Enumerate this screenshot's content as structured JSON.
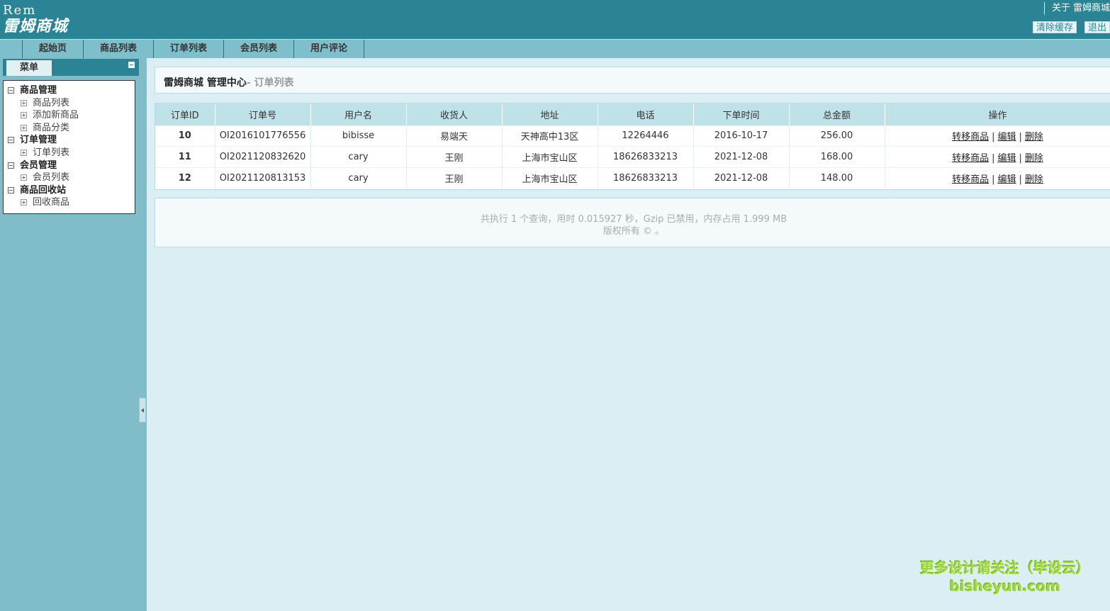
{
  "header": {
    "logo_en": "Rem",
    "logo_cn": "雷姆商城",
    "about_link": "关于 雷姆商城",
    "clear_cache": "清除缓存",
    "logout": "退出"
  },
  "nav": {
    "tabs": [
      {
        "label": "起始页"
      },
      {
        "label": "商品列表"
      },
      {
        "label": "订单列表"
      },
      {
        "label": "会员列表"
      },
      {
        "label": "用户评论"
      }
    ]
  },
  "sidebar": {
    "menu_label": "菜单",
    "tree": [
      {
        "type": "group",
        "label": "商品管理"
      },
      {
        "type": "item",
        "label": "商品列表"
      },
      {
        "type": "item",
        "label": "添加新商品"
      },
      {
        "type": "item",
        "label": "商品分类"
      },
      {
        "type": "group",
        "label": "订单管理"
      },
      {
        "type": "item",
        "label": "订单列表"
      },
      {
        "type": "group",
        "label": "会员管理"
      },
      {
        "type": "item",
        "label": "会员列表"
      },
      {
        "type": "group",
        "label": "商品回收站"
      },
      {
        "type": "item",
        "label": "回收商品"
      }
    ]
  },
  "main": {
    "title": "雷姆商城 管理中心",
    "subtitle": "- 订单列表",
    "table": {
      "columns": [
        "订单ID",
        "订单号",
        "用户名",
        "收货人",
        "地址",
        "电话",
        "下单时间",
        "总金额",
        "操作"
      ],
      "rows": [
        {
          "id": "10",
          "order_no": "OI2016101776556",
          "username": "bibisse",
          "receiver": "易端天",
          "address": "天神高中13区",
          "phone": "12264446",
          "time": "2016-10-17",
          "amount": "256.00"
        },
        {
          "id": "11",
          "order_no": "OI2021120832620",
          "username": "cary",
          "receiver": "王刚",
          "address": "上海市宝山区",
          "phone": "18626833213",
          "time": "2021-12-08",
          "amount": "168.00"
        },
        {
          "id": "12",
          "order_no": "OI2021120813153",
          "username": "cary",
          "receiver": "王刚",
          "address": "上海市宝山区",
          "phone": "18626833213",
          "time": "2021-12-08",
          "amount": "148.00"
        }
      ],
      "actions": {
        "move": "转移商品",
        "edit": "编辑",
        "delete": "删除",
        "separator": "|"
      }
    }
  },
  "footer": {
    "line1": "共执行 1 个查询，用时 0.015927 秒，Gzip 已禁用，内存占用 1.999 MB",
    "line2": "版权所有 © 。"
  },
  "watermark": {
    "line1": "更多设计请关注（毕设云）",
    "line2": "bisheyun.com"
  },
  "colors": {
    "header_bg": "#2a8496",
    "nav_bg": "#7fbfcb",
    "sidebar_bg": "#80bdc9",
    "content_bg": "#dbeef3",
    "table_header_bg": "#bfe2e9",
    "watermark": "#9dd64a"
  }
}
